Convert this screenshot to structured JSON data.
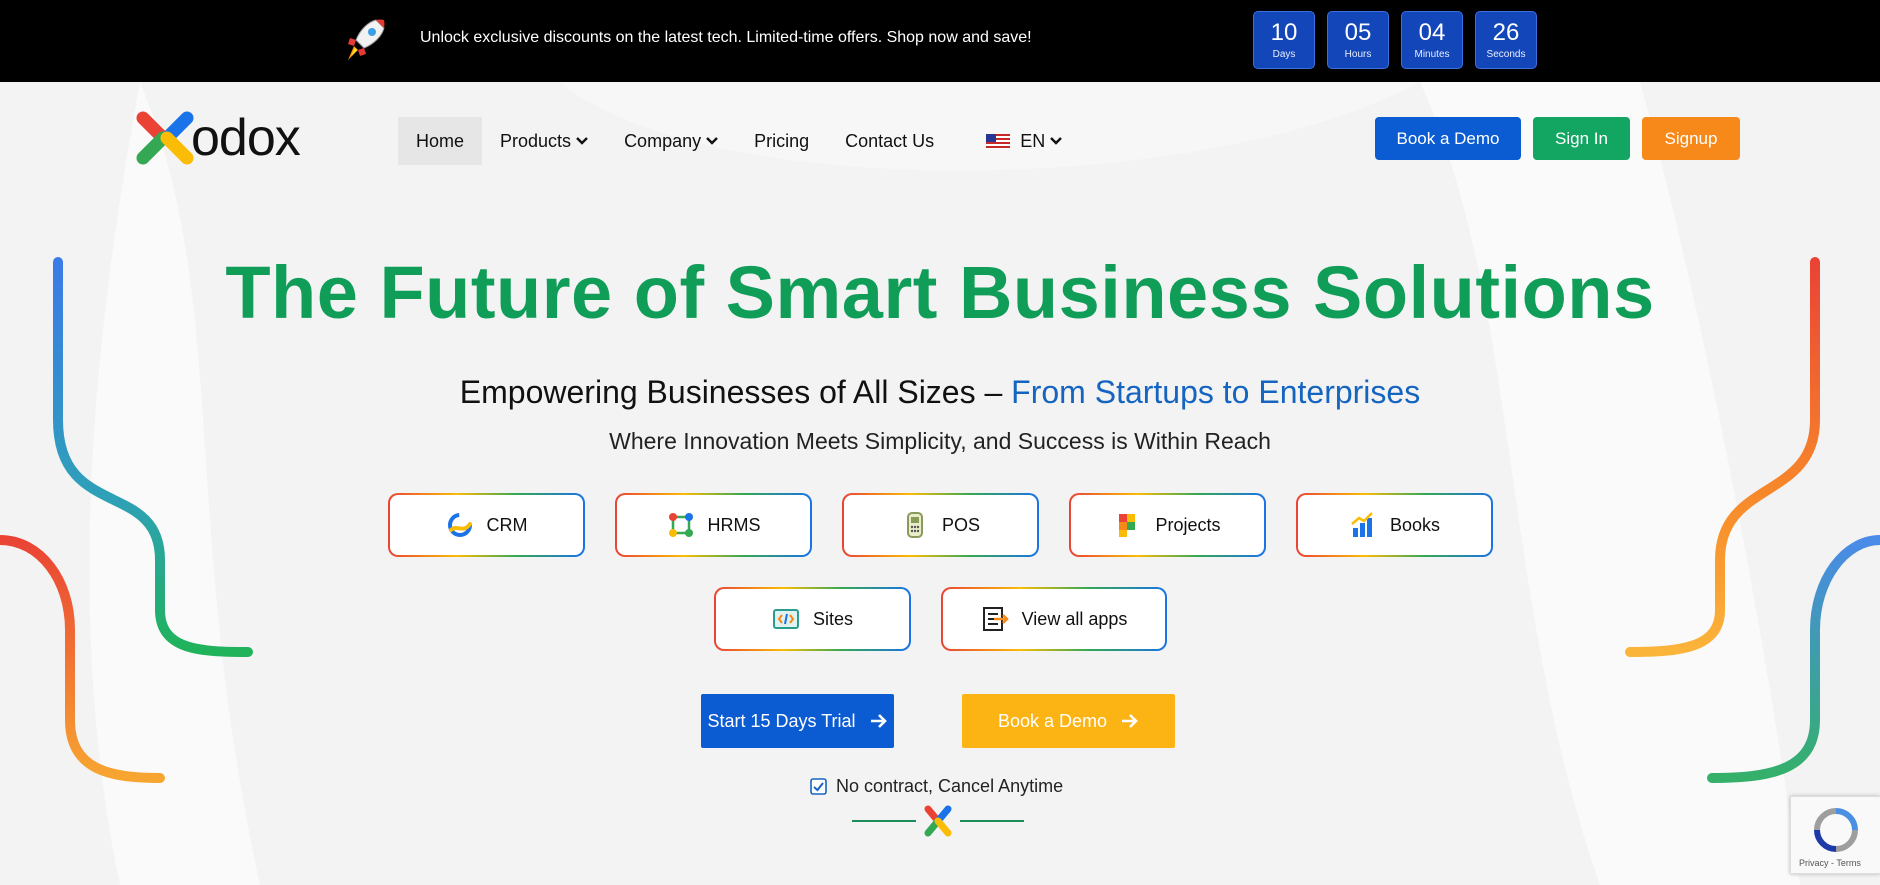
{
  "promo": {
    "message": "Unlock exclusive discounts on the latest tech. Limited-time offers. Shop now and save!",
    "countdown": [
      {
        "value": "10",
        "label": "Days"
      },
      {
        "value": "05",
        "label": "Hours"
      },
      {
        "value": "04",
        "label": "Minutes"
      },
      {
        "value": "26",
        "label": "Seconds"
      }
    ]
  },
  "brand": {
    "wordmark": "odox"
  },
  "nav": {
    "items": [
      {
        "label": "Home",
        "active": true
      },
      {
        "label": "Products",
        "dropdown": true
      },
      {
        "label": "Company",
        "dropdown": true
      },
      {
        "label": "Pricing"
      },
      {
        "label": "Contact Us"
      }
    ],
    "language": "EN"
  },
  "header_buttons": {
    "book_demo": "Book a Demo",
    "sign_in": "Sign In",
    "signup": "Signup"
  },
  "hero": {
    "title": "The Future of Smart Business Solutions",
    "subtitle_main": "Empowering Businesses of All Sizes – ",
    "subtitle_accent": "From Startups to Enterprises",
    "tagline": "Where Innovation Meets Simplicity, and Success is Within Reach"
  },
  "apps": {
    "row1": [
      {
        "label": "CRM",
        "icon": "crm-icon"
      },
      {
        "label": "HRMS",
        "icon": "hrms-icon"
      },
      {
        "label": "POS",
        "icon": "pos-icon"
      },
      {
        "label": "Projects",
        "icon": "projects-icon"
      },
      {
        "label": "Books",
        "icon": "books-icon"
      }
    ],
    "row2": [
      {
        "label": "Sites",
        "icon": "sites-icon"
      },
      {
        "label": "View all apps",
        "icon": "view-all-apps-icon"
      }
    ]
  },
  "cta": {
    "trial": "Start 15 Days Trial",
    "demo": "Book a Demo",
    "no_contract": "No contract, Cancel Anytime"
  },
  "recaptcha": {
    "links": "Privacy - Terms"
  },
  "colors": {
    "primary_green": "#0f9d58",
    "primary_blue": "#0b5bd3",
    "accent_blue_text": "#1565c0",
    "signin_green": "#13a562",
    "signup_orange": "#f7891a",
    "demo_yellow": "#fcb414",
    "countdown_blue": "#1346b8"
  }
}
